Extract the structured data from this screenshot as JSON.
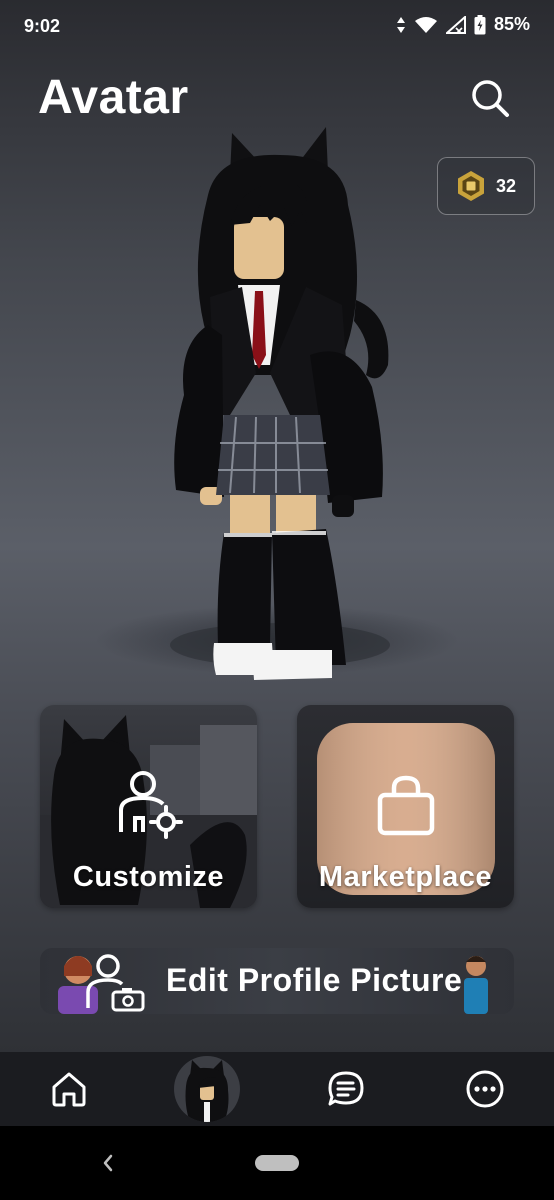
{
  "status_bar": {
    "time": "9:02",
    "battery": "85%",
    "icons": [
      "data-arrows-icon",
      "wifi-icon",
      "signal-icon",
      "battery-icon"
    ]
  },
  "header": {
    "title": "Avatar",
    "search_icon": "search-icon"
  },
  "robux": {
    "icon": "robux-icon",
    "count": "32"
  },
  "cards": {
    "customize": {
      "label": "Customize",
      "icon": "customize-avatar-icon"
    },
    "marketplace": {
      "label": "Marketplace",
      "icon": "shopping-bag-icon"
    },
    "edit_profile": {
      "label": "Edit Profile Picture",
      "icon": "profile-camera-icon"
    }
  },
  "tab_bar": {
    "items": [
      {
        "name": "home",
        "icon": "home-icon"
      },
      {
        "name": "avatar",
        "icon": "avatar-thumbnail"
      },
      {
        "name": "chat",
        "icon": "chat-icon"
      },
      {
        "name": "more",
        "icon": "more-icon"
      }
    ]
  },
  "colors": {
    "background": "#2a2b2f",
    "tab_bar": "#1b1c20",
    "text": "#ffffff",
    "robux_gold": "#c9a33b"
  }
}
